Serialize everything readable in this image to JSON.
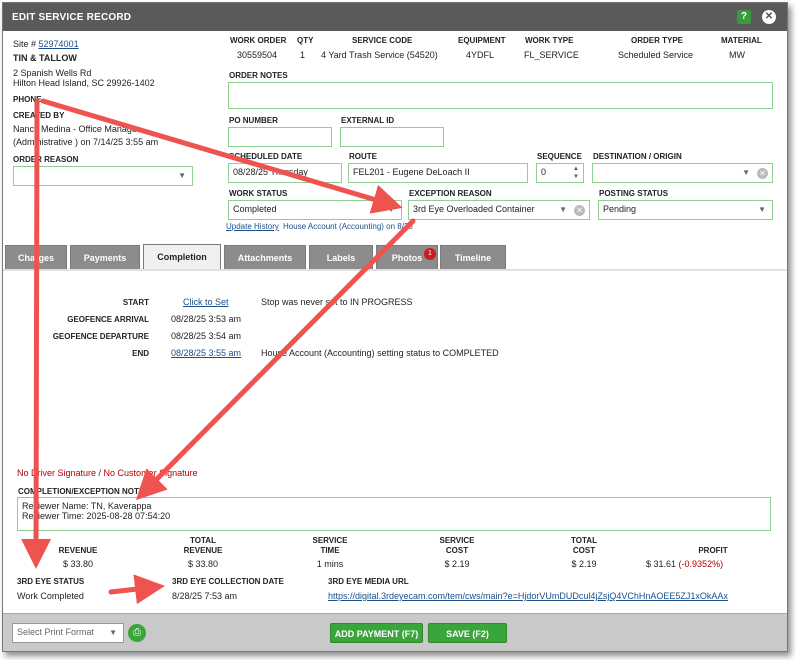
{
  "title": "EDIT SERVICE RECORD",
  "help_label": "?",
  "close_label": "✕",
  "site": {
    "label": "Site #",
    "number": "52974001",
    "name": "TIN & TALLOW",
    "address1": "2 Spanish Wells Rd",
    "address2": "Hilton Head Island, SC 29926-1402",
    "phone_label": "PHONE",
    "created_by_label": "CREATED BY",
    "created_by_line1": "Nancy Medina - Office Manager",
    "created_by_line2": "(Administrative ) on 7/14/25 3:55 am",
    "order_reason_label": "ORDER REASON"
  },
  "order": {
    "headers": [
      "WORK ORDER",
      "QTY",
      "SERVICE CODE",
      "EQUIPMENT",
      "WORK TYPE",
      "ORDER TYPE",
      "MATERIAL"
    ],
    "values": [
      "30559504",
      "1",
      "4 Yard Trash Service (54520)",
      "4YDFL",
      "FL_SERVICE",
      "Scheduled Service",
      "MW"
    ],
    "notes_label": "ORDER NOTES",
    "po_label": "PO NUMBER",
    "external_label": "EXTERNAL ID",
    "scheduled_label": "SCHEDULED DATE",
    "scheduled_value": "08/28/25 Thursday",
    "route_label": "ROUTE",
    "route_value": "FEL201 - Eugene DeLoach II",
    "sequence_label": "SEQUENCE",
    "sequence_value": "0",
    "destination_label": "DESTINATION / ORIGIN",
    "work_status_label": "WORK STATUS",
    "work_status_value": "Completed",
    "exception_label": "EXCEPTION REASON",
    "exception_value": "3rd Eye Overloaded Container",
    "posting_label": "POSTING STATUS",
    "posting_value": "Pending",
    "update_history": "Update History",
    "history_note": "House Account (Accounting) on 8/28"
  },
  "tabs": [
    {
      "label": "Charges"
    },
    {
      "label": "Payments"
    },
    {
      "label": "Completion"
    },
    {
      "label": "Attachments"
    },
    {
      "label": "Labels"
    },
    {
      "label": "Photos",
      "badge": "1"
    },
    {
      "label": "Timeline"
    }
  ],
  "completion": {
    "start_label": "START",
    "start_value": "Click to Set",
    "start_note": "Stop was never set to IN PROGRESS",
    "geo_arrival_label": "GEOFENCE ARRIVAL",
    "geo_arrival_value": "08/28/25 3:53 am",
    "geo_departure_label": "GEOFENCE DEPARTURE",
    "geo_departure_value": "08/28/25 3:54 am",
    "end_label": "END",
    "end_value": "08/28/25 3:55 am",
    "end_note": "House Account (Accounting) setting status to COMPLETED",
    "no_driver_sig": "No Driver Signature",
    "sig_sep": " / ",
    "no_customer_sig": "No Customer Signature",
    "notes_label": "COMPLETION/EXCEPTION NOTES",
    "notes_line1": "Reviewer Name: TN, Kaverappa",
    "notes_line2": "Reviewer Time: 2025-08-28 07:54:20"
  },
  "financials": {
    "revenue_label": "REVENUE",
    "revenue_value": "$ 33.80",
    "total_revenue_label1": "TOTAL",
    "total_revenue_label2": "REVENUE",
    "total_revenue_value": "$ 33.80",
    "service_time_label1": "SERVICE",
    "service_time_label2": "TIME",
    "service_time_value": "1 mins",
    "service_cost_label1": "SERVICE",
    "service_cost_label2": "COST",
    "service_cost_value": "$ 2.19",
    "total_cost_label1": "TOTAL",
    "total_cost_label2": "COST",
    "total_cost_value": "$ 2.19",
    "profit_label": "PROFIT",
    "profit_value": "$ 31.61",
    "profit_pct": "(-0.9352%)"
  },
  "third_eye": {
    "status_label": "3RD EYE STATUS",
    "status_value": "Work Completed",
    "date_label": "3RD EYE COLLECTION DATE",
    "date_value": "8/28/25 7:53 am",
    "url_label": "3RD EYE MEDIA URL",
    "url_value": "https://digital.3rdeyecam.com/tem/cws/main?e=HjdorVUmDUDcul4jZsjQ4VChHnAOEE5ZJ1xOkAAx"
  },
  "footer": {
    "print_placeholder": "Select Print Format",
    "add_payment": "ADD PAYMENT (F7)",
    "save": "SAVE (F2)"
  },
  "colors": {
    "accent_green": "#3aa53a",
    "arrow_red": "#ef5350",
    "title_bar": "#5a5a5a"
  }
}
